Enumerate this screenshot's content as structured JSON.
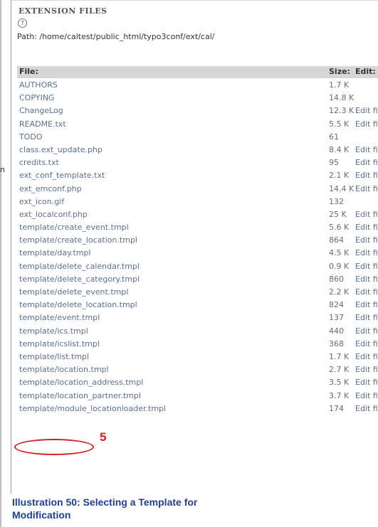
{
  "stray_mark": "n",
  "panel": {
    "title": "EXTENSION FILES",
    "help_icon": "help-circle-icon",
    "help_glyph": "?",
    "path_text": "Path: /home/caltest/public_html/typo3conf/ext/cal/"
  },
  "table": {
    "headers": {
      "file": "File:",
      "size": "Size:",
      "edit": "Edit:"
    },
    "rows": [
      {
        "file": "AUTHORS",
        "size": "1.7 K",
        "edit": ""
      },
      {
        "file": "COPYING",
        "size": "14.8 K",
        "edit": ""
      },
      {
        "file": "ChangeLog",
        "size": "12.3 K",
        "edit": "Edit file"
      },
      {
        "file": "README.txt",
        "size": "5.5 K",
        "edit": "Edit file"
      },
      {
        "file": "TODO",
        "size": "61",
        "edit": ""
      },
      {
        "file": "class.ext_update.php",
        "size": "8.4 K",
        "edit": "Edit file"
      },
      {
        "file": "credits.txt",
        "size": "95",
        "edit": "Edit file"
      },
      {
        "file": "ext_conf_template.txt",
        "size": "2.1 K",
        "edit": "Edit file"
      },
      {
        "file": "ext_emconf.php",
        "size": "14.4 K",
        "edit": "Edit file"
      },
      {
        "file": "ext_icon.gif",
        "size": "132",
        "edit": ""
      },
      {
        "file": "ext_localconf.php",
        "size": "25 K",
        "edit": "Edit file"
      },
      {
        "file": "template/create_event.tmpl",
        "size": "5.6 K",
        "edit": "Edit file"
      },
      {
        "file": "template/create_location.tmpl",
        "size": "864",
        "edit": "Edit file"
      },
      {
        "file": "template/day.tmpl",
        "size": "4.5 K",
        "edit": "Edit file"
      },
      {
        "file": "template/delete_calendar.tmpl",
        "size": "0.9 K",
        "edit": "Edit file"
      },
      {
        "file": "template/delete_category.tmpl",
        "size": "860",
        "edit": "Edit file"
      },
      {
        "file": "template/delete_event.tmpl",
        "size": "2.2 K",
        "edit": "Edit file"
      },
      {
        "file": "template/delete_location.tmpl",
        "size": "824",
        "edit": "Edit file"
      },
      {
        "file": "template/event.tmpl",
        "size": "137",
        "edit": "Edit file"
      },
      {
        "file": "template/ics.tmpl",
        "size": "440",
        "edit": "Edit file"
      },
      {
        "file": "template/icslist.tmpl",
        "size": "368",
        "edit": "Edit file"
      },
      {
        "file": "template/list.tmpl",
        "size": "1.7 K",
        "edit": "Edit file"
      },
      {
        "file": "template/location.tmpl",
        "size": "2.7 K",
        "edit": "Edit file"
      },
      {
        "file": "template/location_address.tmpl",
        "size": "3.5 K",
        "edit": "Edit file"
      },
      {
        "file": "template/location_partner.tmpl",
        "size": "3.7 K",
        "edit": "Edit file"
      },
      {
        "file": "template/module_locationloader.tmpl",
        "size": "174",
        "edit": "Edit file"
      }
    ]
  },
  "callout": {
    "number": "5",
    "color": "#d02020"
  },
  "caption": "Illustration 50: Selecting a Template for Modification"
}
